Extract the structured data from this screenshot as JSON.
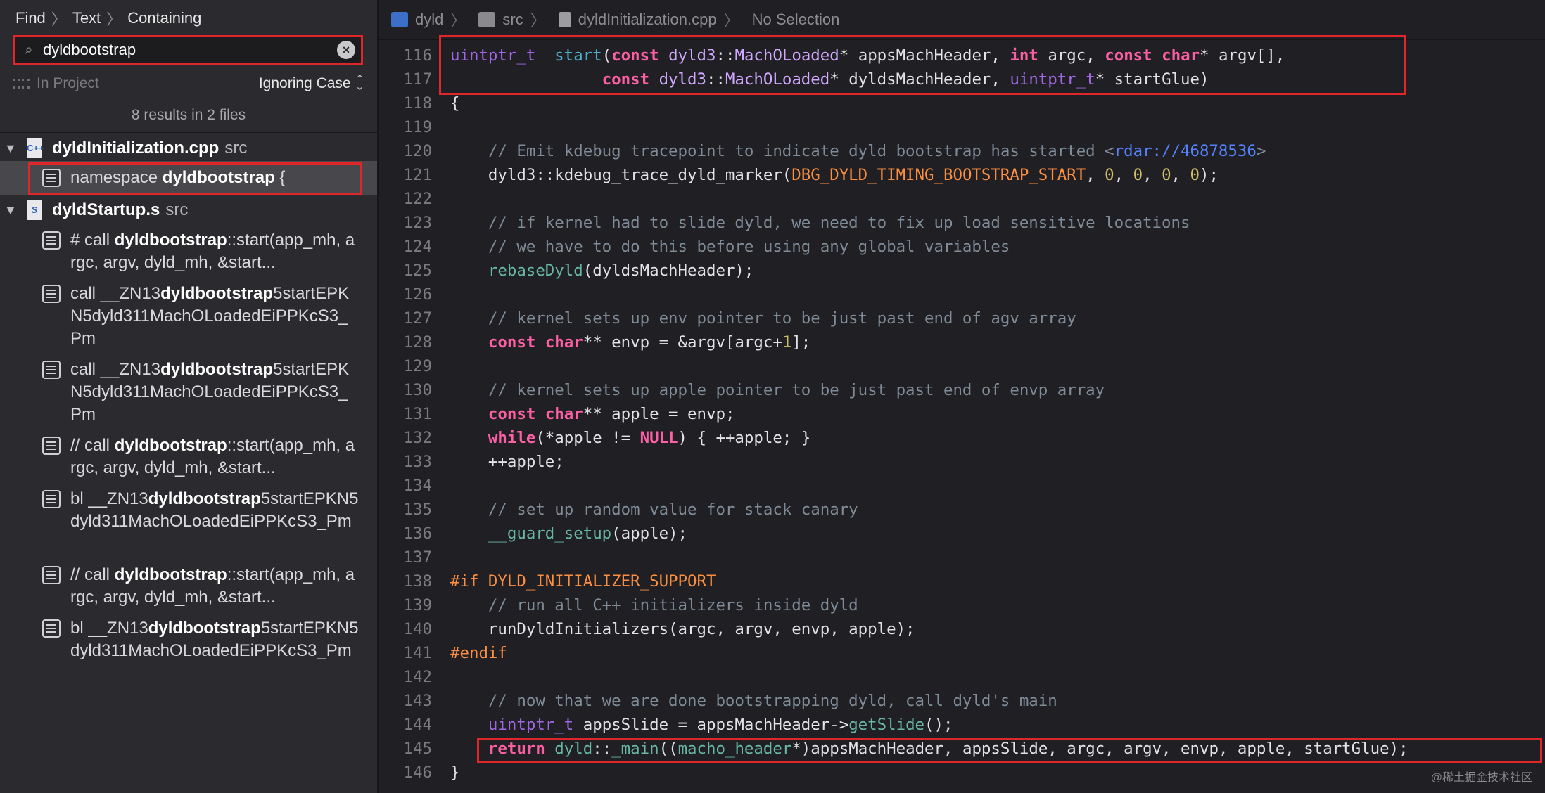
{
  "find_bar": {
    "find": "Find",
    "text": "Text",
    "containing": "Containing"
  },
  "search": {
    "value": "dyldbootstrap",
    "placeholder": ""
  },
  "scope": {
    "project": "In Project",
    "case": "Ignoring Case"
  },
  "results_summary": "8 results in 2 files",
  "files": [
    {
      "name": "dyldInitialization.cpp",
      "dir": "src",
      "icon": "C++"
    },
    {
      "name": "dyldStartup.s",
      "dir": "src",
      "icon": "S"
    }
  ],
  "matches": [
    {
      "pre": "namespace ",
      "hit": "dyldbootstrap",
      "post": " {"
    },
    {
      "pre": "# call ",
      "hit": "dyldbootstrap",
      "post": "::start(app_mh, argc, argv, dyld_mh, &start..."
    },
    {
      "pre": "call   __ZN13",
      "hit": "dyldbootstrap",
      "post": "5startEPKN5dyld311MachOLoadedEiPPKcS3_Pm"
    },
    {
      "pre": "call   __ZN13",
      "hit": "dyldbootstrap",
      "post": "5startEPKN5dyld311MachOLoadedEiPPKcS3_Pm"
    },
    {
      "pre": "// call ",
      "hit": "dyldbootstrap",
      "post": "::start(app_mh, argc, argv, dyld_mh, &start..."
    },
    {
      "pre": "bl     __ZN13",
      "hit": "dyldbootstrap",
      "post": "5startEPKN5dyld311MachOLoadedEiPPKcS3_Pm"
    },
    {
      "pre": "// call ",
      "hit": "dyldbootstrap",
      "post": "::start(app_mh, argc, argv, dyld_mh, &start..."
    },
    {
      "pre": "bl     __ZN13",
      "hit": "dyldbootstrap",
      "post": "5startEPKN5dyld311MachOLoadedEiPPKcS3_Pm"
    }
  ],
  "jump_bar": {
    "project": "dyld",
    "folder": "src",
    "file": "dyldInitialization.cpp",
    "selection": "No Selection"
  },
  "code_lines": [
    {
      "n": "116",
      "tokens": [
        [
          "ty2",
          "uintptr_t"
        ],
        [
          "",
          "  "
        ],
        [
          "fn2",
          "start"
        ],
        [
          "",
          "("
        ],
        [
          "kw",
          "const"
        ],
        [
          "",
          " "
        ],
        [
          "ty",
          "dyld3"
        ],
        [
          "",
          "::"
        ],
        [
          "ty",
          "MachOLoaded"
        ],
        [
          "",
          "* appsMachHeader, "
        ],
        [
          "kw",
          "int"
        ],
        [
          "",
          " argc, "
        ],
        [
          "kw",
          "const"
        ],
        [
          "",
          " "
        ],
        [
          "kw",
          "char"
        ],
        [
          "",
          "* argv[],"
        ]
      ]
    },
    {
      "n": "117",
      "tokens": [
        [
          "",
          "                "
        ],
        [
          "kw",
          "const"
        ],
        [
          "",
          " "
        ],
        [
          "ty",
          "dyld3"
        ],
        [
          "",
          "::"
        ],
        [
          "ty",
          "MachOLoaded"
        ],
        [
          "",
          "* dyldsMachHeader, "
        ],
        [
          "ty2",
          "uintptr_t"
        ],
        [
          "",
          "* startGlue)"
        ]
      ]
    },
    {
      "n": "118",
      "tokens": [
        [
          "",
          "{"
        ]
      ]
    },
    {
      "n": "119",
      "tokens": []
    },
    {
      "n": "120",
      "tokens": [
        [
          "",
          "    "
        ],
        [
          "cm",
          "// Emit kdebug tracepoint to indicate dyld bootstrap has started <"
        ],
        [
          "url",
          "rdar://46878536"
        ],
        [
          "cm",
          ">"
        ]
      ]
    },
    {
      "n": "121",
      "tokens": [
        [
          "",
          "    dyld3::kdebug_trace_dyld_marker("
        ],
        [
          "mac",
          "DBG_DYLD_TIMING_BOOTSTRAP_START"
        ],
        [
          "",
          ", "
        ],
        [
          "num",
          "0"
        ],
        [
          "",
          ", "
        ],
        [
          "num",
          "0"
        ],
        [
          "",
          ", "
        ],
        [
          "num",
          "0"
        ],
        [
          "",
          ", "
        ],
        [
          "num",
          "0"
        ],
        [
          "",
          ");"
        ]
      ]
    },
    {
      "n": "122",
      "tokens": []
    },
    {
      "n": "123",
      "tokens": [
        [
          "",
          "    "
        ],
        [
          "cm",
          "// if kernel had to slide dyld, we need to fix up load sensitive locations"
        ]
      ]
    },
    {
      "n": "124",
      "tokens": [
        [
          "",
          "    "
        ],
        [
          "cm",
          "// we have to do this before using any global variables"
        ]
      ]
    },
    {
      "n": "125",
      "tokens": [
        [
          "",
          "    "
        ],
        [
          "fn",
          "rebaseDyld"
        ],
        [
          "",
          "(dyldsMachHeader);"
        ]
      ]
    },
    {
      "n": "126",
      "tokens": []
    },
    {
      "n": "127",
      "tokens": [
        [
          "",
          "    "
        ],
        [
          "cm",
          "// kernel sets up env pointer to be just past end of agv array"
        ]
      ]
    },
    {
      "n": "128",
      "tokens": [
        [
          "",
          "    "
        ],
        [
          "kw",
          "const"
        ],
        [
          "",
          " "
        ],
        [
          "kw",
          "char"
        ],
        [
          "",
          "** envp = &argv[argc+"
        ],
        [
          "num",
          "1"
        ],
        [
          "",
          "];"
        ]
      ]
    },
    {
      "n": "129",
      "tokens": []
    },
    {
      "n": "130",
      "tokens": [
        [
          "",
          "    "
        ],
        [
          "cm",
          "// kernel sets up apple pointer to be just past end of envp array"
        ]
      ]
    },
    {
      "n": "131",
      "tokens": [
        [
          "",
          "    "
        ],
        [
          "kw",
          "const"
        ],
        [
          "",
          " "
        ],
        [
          "kw",
          "char"
        ],
        [
          "",
          "** apple = envp;"
        ]
      ]
    },
    {
      "n": "132",
      "tokens": [
        [
          "",
          "    "
        ],
        [
          "kw",
          "while"
        ],
        [
          "",
          "(*apple != "
        ],
        [
          "kw",
          "NULL"
        ],
        [
          "",
          ") { ++apple; }"
        ]
      ]
    },
    {
      "n": "133",
      "tokens": [
        [
          "",
          "    ++apple;"
        ]
      ]
    },
    {
      "n": "134",
      "tokens": []
    },
    {
      "n": "135",
      "tokens": [
        [
          "",
          "    "
        ],
        [
          "cm",
          "// set up random value for stack canary"
        ]
      ]
    },
    {
      "n": "136",
      "tokens": [
        [
          "",
          "    "
        ],
        [
          "fn",
          "__guard_setup"
        ],
        [
          "",
          "(apple);"
        ]
      ]
    },
    {
      "n": "137",
      "tokens": []
    },
    {
      "n": "138",
      "tokens": [
        [
          "mac",
          "#if DYLD_INITIALIZER_SUPPORT"
        ]
      ]
    },
    {
      "n": "139",
      "tokens": [
        [
          "",
          "    "
        ],
        [
          "cm",
          "// run all C++ initializers inside dyld"
        ]
      ]
    },
    {
      "n": "140",
      "tokens": [
        [
          "",
          "    runDyldInitializers(argc, argv, envp, apple);"
        ]
      ]
    },
    {
      "n": "141",
      "tokens": [
        [
          "mac",
          "#endif"
        ]
      ]
    },
    {
      "n": "142",
      "tokens": []
    },
    {
      "n": "143",
      "tokens": [
        [
          "",
          "    "
        ],
        [
          "cm",
          "// now that we are done bootstrapping dyld, call dyld's main"
        ]
      ]
    },
    {
      "n": "144",
      "tokens": [
        [
          "",
          "    "
        ],
        [
          "ty2",
          "uintptr_t"
        ],
        [
          "",
          " appsSlide = appsMachHeader->"
        ],
        [
          "fn",
          "getSlide"
        ],
        [
          "",
          "();"
        ]
      ]
    },
    {
      "n": "145",
      "tokens": [
        [
          "",
          "    "
        ],
        [
          "kw",
          "return"
        ],
        [
          "",
          " "
        ],
        [
          "fn",
          "dyld"
        ],
        [
          "",
          "::"
        ],
        [
          "fn",
          "_main"
        ],
        [
          "",
          "(("
        ],
        [
          "fn",
          "macho_header"
        ],
        [
          "",
          "*)appsMachHeader, appsSlide, argc, argv, envp, apple, startGlue);"
        ]
      ]
    },
    {
      "n": "146",
      "tokens": [
        [
          "",
          "}"
        ]
      ]
    }
  ],
  "watermark": "@稀土掘金技术社区",
  "colors": {
    "highlight_box": "#e0252b",
    "keyword": "#fc5fa3",
    "comment": "#7f8c98",
    "type": "#d0a8ff",
    "function": "#67b7a4",
    "macro": "#fd8f3f",
    "number": "#d0bf69",
    "url": "#5482ff"
  },
  "icons": {
    "search": "magnifier-icon",
    "clear": "clear-circle-icon",
    "scope": "scope-grid-icon",
    "updown": "updown-chevron-icon",
    "match": "text-lines-icon",
    "disclosure": "disclosure-triangle-icon"
  }
}
